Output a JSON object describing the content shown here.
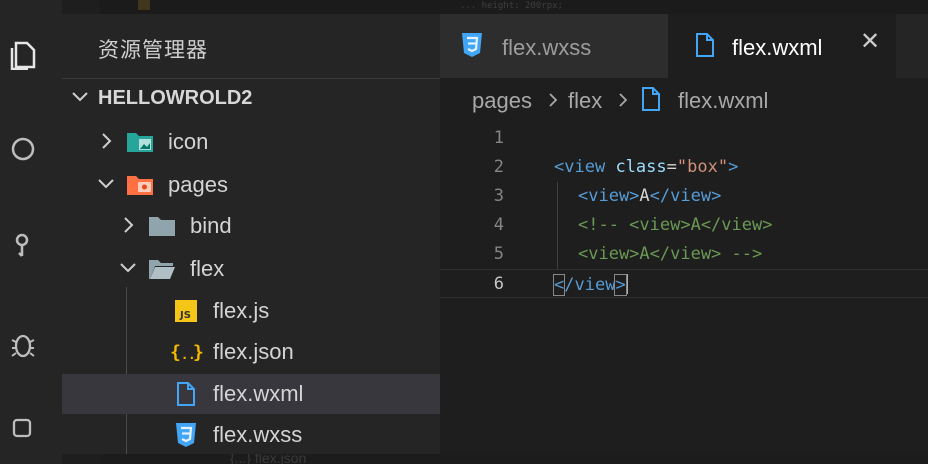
{
  "ghost": {
    "top_text": "...  height: 200rpx;",
    "bottom_text": "{...}  flex.json"
  },
  "sidebar": {
    "title": "资源管理器",
    "root": "HELLOWROLD2",
    "items": [
      {
        "label": "icon",
        "icon": "image-folder-icon",
        "type": "folder",
        "expanded": false
      },
      {
        "label": "pages",
        "icon": "pages-folder-icon",
        "type": "folder",
        "expanded": true
      },
      {
        "label": "bind",
        "icon": "folder-icon",
        "type": "folder",
        "expanded": false
      },
      {
        "label": "flex",
        "icon": "folder-open-icon",
        "type": "folder",
        "expanded": true
      },
      {
        "label": "flex.js",
        "icon": "js-file-icon",
        "type": "file"
      },
      {
        "label": "flex.json",
        "icon": "json-file-icon",
        "type": "file"
      },
      {
        "label": "flex.wxml",
        "icon": "wxml-file-icon",
        "type": "file",
        "selected": true
      },
      {
        "label": "flex.wxss",
        "icon": "css-file-icon",
        "type": "file"
      }
    ]
  },
  "tabs": [
    {
      "label": "flex.wxss",
      "icon": "css-file-icon",
      "active": false
    },
    {
      "label": "flex.wxml",
      "icon": "wxml-file-icon",
      "active": true,
      "close": "✕"
    }
  ],
  "breadcrumb": [
    "pages",
    "flex",
    "flex.wxml"
  ],
  "editor": {
    "lines": [
      {
        "n": "1"
      },
      {
        "n": "2",
        "tag_open": "<view",
        "attr": "class",
        "eq": "=",
        "val": "\"box\"",
        "tag_close": ">"
      },
      {
        "n": "3",
        "open": "<view>",
        "text": "A",
        "close": "</view>"
      },
      {
        "n": "4",
        "comment": "<!-- <view>A</view>"
      },
      {
        "n": "5",
        "comment": "<view>A</view> -->"
      },
      {
        "n": "6",
        "lt": "<",
        "name": "/view",
        "gt": ">"
      }
    ],
    "current_line": "6"
  },
  "colors": {
    "tag": "#569cd6",
    "attr": "#9cdcfe",
    "string": "#ce9178",
    "comment": "#6a9955",
    "css_icon": "#42a5f5",
    "js_icon": "#f5c518",
    "json_icon": "#f5b800"
  }
}
